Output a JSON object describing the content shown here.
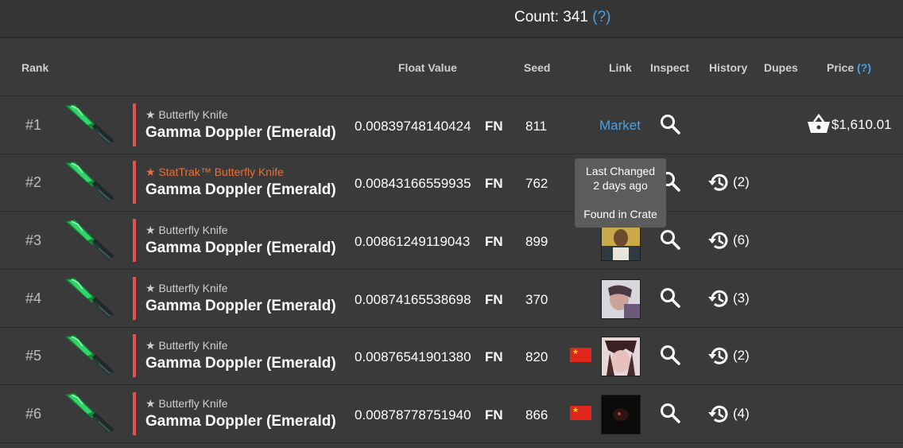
{
  "count": {
    "label": "Count: 341",
    "help": "(?)"
  },
  "columns": {
    "rank": "Rank",
    "float": "Float Value",
    "seed": "Seed",
    "link": "Link",
    "inspect": "Inspect",
    "history": "History",
    "dupes": "Dupes",
    "price": "Price",
    "price_help": "(?)"
  },
  "rows": [
    {
      "rank": "#1",
      "sub": "★ Butterfly Knife",
      "name": "Gamma Doppler (Emerald)",
      "float": "0.00839748140424",
      "wear": "FN",
      "seed": "811",
      "link": "Market",
      "history": "",
      "price": "$1,610.01"
    },
    {
      "rank": "#2",
      "sub": "★ StatTrak™ Butterfly Knife",
      "name": "Gamma Doppler (Emerald)",
      "float": "0.00843166559935",
      "wear": "FN",
      "seed": "762",
      "history": "(2)"
    },
    {
      "rank": "#3",
      "sub": "★ Butterfly Knife",
      "name": "Gamma Doppler (Emerald)",
      "float": "0.00861249119043",
      "wear": "FN",
      "seed": "899",
      "history": "(6)"
    },
    {
      "rank": "#4",
      "sub": "★ Butterfly Knife",
      "name": "Gamma Doppler (Emerald)",
      "float": "0.00874165538698",
      "wear": "FN",
      "seed": "370",
      "history": "(3)"
    },
    {
      "rank": "#5",
      "sub": "★ Butterfly Knife",
      "name": "Gamma Doppler (Emerald)",
      "float": "0.00876541901380",
      "wear": "FN",
      "seed": "820",
      "history": "(2)"
    },
    {
      "rank": "#6",
      "sub": "★ Butterfly Knife",
      "name": "Gamma Doppler (Emerald)",
      "float": "0.00878778751940",
      "wear": "FN",
      "seed": "866",
      "history": "(4)"
    }
  ],
  "tooltip": {
    "line1": "Last Changed",
    "line2": "2 days ago",
    "line3": "Found in Crate"
  },
  "colors": {
    "accent": "#4aa0e6",
    "stattrak": "#e8703a",
    "rarity_bar": "#e0524f",
    "background": "#3a3a3a"
  },
  "icons": {
    "inspect": "search-icon",
    "history": "history-icon",
    "price": "basket-icon",
    "flag": "china-flag-icon",
    "item": "butterfly-knife-icon"
  }
}
